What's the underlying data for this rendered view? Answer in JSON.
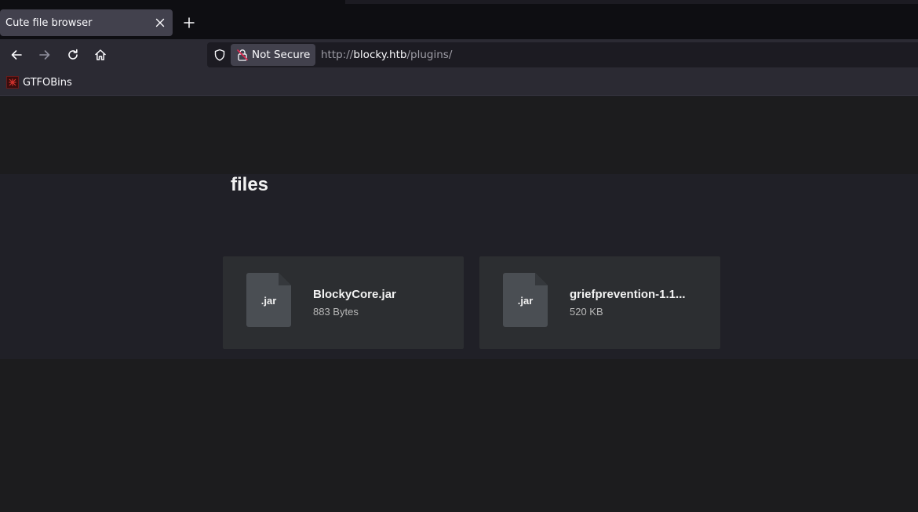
{
  "browser": {
    "tab": {
      "title": "Cute file browser"
    },
    "security_label": "Not Secure",
    "url": {
      "scheme": "http://",
      "host": "blocky.htb",
      "path": "/plugins/"
    },
    "bookmarks": [
      {
        "label": "GTFOBins"
      }
    ]
  },
  "page": {
    "section_title": "files",
    "files": [
      {
        "icon_label": ".jar",
        "name": "BlockyCore.jar",
        "size": "883 Bytes"
      },
      {
        "icon_label": ".jar",
        "name": "griefprevention-1.1...",
        "size": "520 KB"
      }
    ]
  }
}
